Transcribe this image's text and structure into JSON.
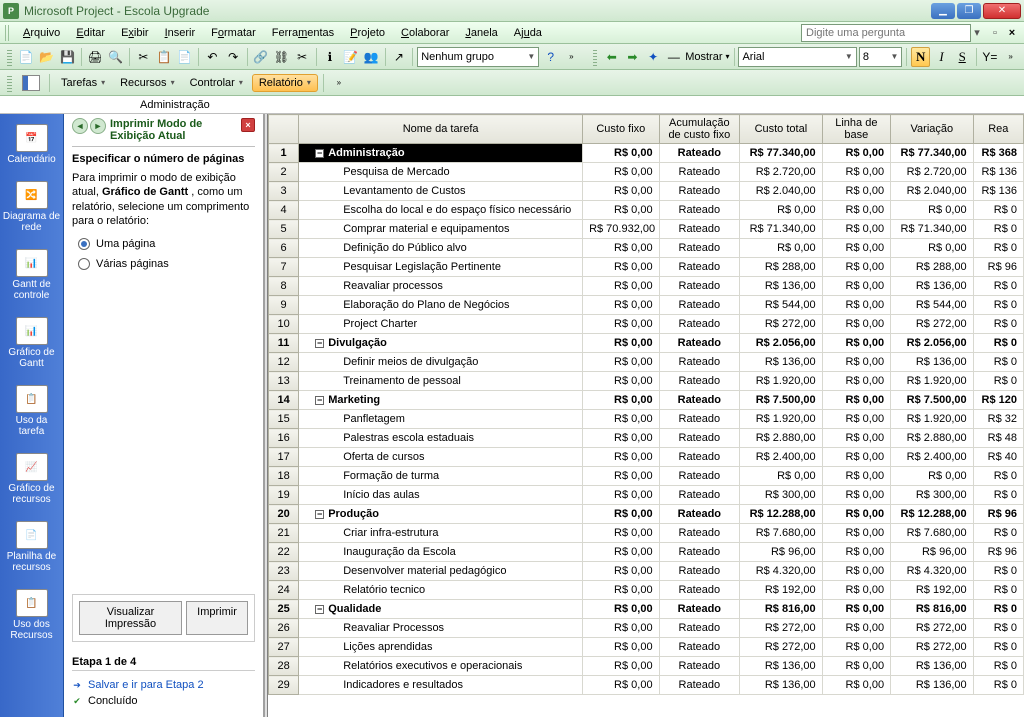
{
  "titlebar": {
    "app": "Microsoft Project",
    "doc": "Escola Upgrade"
  },
  "menubar": {
    "items": [
      "Arquivo",
      "Editar",
      "Exibir",
      "Inserir",
      "Formatar",
      "Ferramentas",
      "Projeto",
      "Colaborar",
      "Janela",
      "Ajuda"
    ],
    "search_placeholder": "Digite uma pergunta"
  },
  "toolbar1": {
    "group_combo": "Nenhum grupo",
    "show_label": "Mostrar",
    "font_combo": "Arial",
    "size_combo": "8"
  },
  "toolbar2": {
    "buttons": [
      "Tarefas",
      "Recursos",
      "Controlar",
      "Relatório"
    ]
  },
  "subheader": "Administração",
  "viewbar": {
    "items": [
      "Calendário",
      "Diagrama de rede",
      "Gantt de controle",
      "Gráfico de Gantt",
      "Uso da tarefa",
      "Gráfico de recursos",
      "Planilha de recursos",
      "Uso dos Recursos"
    ]
  },
  "guide": {
    "title": "Imprimir Modo de Exibição Atual",
    "section_title": "Especificar o número de páginas",
    "text_before": "Para imprimir o modo de exibição atual, ",
    "text_bold": "Gráfico de Gantt",
    "text_after": " , como um relatório, selecione um comprimento para o relatório:",
    "radio1": "Uma página",
    "radio2": "Várias páginas",
    "btn_preview": "Visualizar Impressão",
    "btn_print": "Imprimir",
    "step_label": "Etapa 1 de 4",
    "link_save": "Salvar e ir para Etapa 2",
    "link_done": "Concluído"
  },
  "grid": {
    "columns": [
      "Nome da tarefa",
      "Custo fixo",
      "Acumulação de custo fixo",
      "Custo total",
      "Linha de base",
      "Variação",
      "Rea"
    ],
    "rows": [
      {
        "n": 1,
        "level": 0,
        "bold": true,
        "sel": true,
        "name": "Administração",
        "fixed": "R$ 0,00",
        "accrual": "Rateado",
        "total": "R$ 77.340,00",
        "base": "R$ 0,00",
        "var": "R$ 77.340,00",
        "rem": "R$ 368"
      },
      {
        "n": 2,
        "level": 1,
        "name": "Pesquisa de Mercado",
        "fixed": "R$ 0,00",
        "accrual": "Rateado",
        "total": "R$ 2.720,00",
        "base": "R$ 0,00",
        "var": "R$ 2.720,00",
        "rem": "R$ 136"
      },
      {
        "n": 3,
        "level": 1,
        "name": "Levantamento de Custos",
        "fixed": "R$ 0,00",
        "accrual": "Rateado",
        "total": "R$ 2.040,00",
        "base": "R$ 0,00",
        "var": "R$ 2.040,00",
        "rem": "R$ 136"
      },
      {
        "n": 4,
        "level": 1,
        "name": "Escolha do local e do espaço físico necessário",
        "fixed": "R$ 0,00",
        "accrual": "Rateado",
        "total": "R$ 0,00",
        "base": "R$ 0,00",
        "var": "R$ 0,00",
        "rem": "R$ 0"
      },
      {
        "n": 5,
        "level": 1,
        "name": "Comprar material e equipamentos",
        "fixed": "R$ 70.932,00",
        "accrual": "Rateado",
        "total": "R$ 71.340,00",
        "base": "R$ 0,00",
        "var": "R$ 71.340,00",
        "rem": "R$ 0"
      },
      {
        "n": 6,
        "level": 1,
        "name": "Definição do Público alvo",
        "fixed": "R$ 0,00",
        "accrual": "Rateado",
        "total": "R$ 0,00",
        "base": "R$ 0,00",
        "var": "R$ 0,00",
        "rem": "R$ 0"
      },
      {
        "n": 7,
        "level": 1,
        "name": "Pesquisar Legislação Pertinente",
        "fixed": "R$ 0,00",
        "accrual": "Rateado",
        "total": "R$ 288,00",
        "base": "R$ 0,00",
        "var": "R$ 288,00",
        "rem": "R$ 96"
      },
      {
        "n": 8,
        "level": 1,
        "name": "Reavaliar processos",
        "fixed": "R$ 0,00",
        "accrual": "Rateado",
        "total": "R$ 136,00",
        "base": "R$ 0,00",
        "var": "R$ 136,00",
        "rem": "R$ 0"
      },
      {
        "n": 9,
        "level": 1,
        "name": "Elaboração do Plano de Negócios",
        "fixed": "R$ 0,00",
        "accrual": "Rateado",
        "total": "R$ 544,00",
        "base": "R$ 0,00",
        "var": "R$ 544,00",
        "rem": "R$ 0"
      },
      {
        "n": 10,
        "level": 1,
        "name": "Project Charter",
        "fixed": "R$ 0,00",
        "accrual": "Rateado",
        "total": "R$ 272,00",
        "base": "R$ 0,00",
        "var": "R$ 272,00",
        "rem": "R$ 0"
      },
      {
        "n": 11,
        "level": 0,
        "bold": true,
        "name": "Divulgação",
        "fixed": "R$ 0,00",
        "accrual": "Rateado",
        "total": "R$ 2.056,00",
        "base": "R$ 0,00",
        "var": "R$ 2.056,00",
        "rem": "R$ 0"
      },
      {
        "n": 12,
        "level": 1,
        "name": "Definir meios de divulgação",
        "fixed": "R$ 0,00",
        "accrual": "Rateado",
        "total": "R$ 136,00",
        "base": "R$ 0,00",
        "var": "R$ 136,00",
        "rem": "R$ 0"
      },
      {
        "n": 13,
        "level": 1,
        "name": "Treinamento de pessoal",
        "fixed": "R$ 0,00",
        "accrual": "Rateado",
        "total": "R$ 1.920,00",
        "base": "R$ 0,00",
        "var": "R$ 1.920,00",
        "rem": "R$ 0"
      },
      {
        "n": 14,
        "level": 0,
        "bold": true,
        "name": "Marketing",
        "fixed": "R$ 0,00",
        "accrual": "Rateado",
        "total": "R$ 7.500,00",
        "base": "R$ 0,00",
        "var": "R$ 7.500,00",
        "rem": "R$ 120"
      },
      {
        "n": 15,
        "level": 1,
        "name": "Panfletagem",
        "fixed": "R$ 0,00",
        "accrual": "Rateado",
        "total": "R$ 1.920,00",
        "base": "R$ 0,00",
        "var": "R$ 1.920,00",
        "rem": "R$ 32"
      },
      {
        "n": 16,
        "level": 1,
        "name": "Palestras escola estaduais",
        "fixed": "R$ 0,00",
        "accrual": "Rateado",
        "total": "R$ 2.880,00",
        "base": "R$ 0,00",
        "var": "R$ 2.880,00",
        "rem": "R$ 48"
      },
      {
        "n": 17,
        "level": 1,
        "name": "Oferta de cursos",
        "fixed": "R$ 0,00",
        "accrual": "Rateado",
        "total": "R$ 2.400,00",
        "base": "R$ 0,00",
        "var": "R$ 2.400,00",
        "rem": "R$ 40"
      },
      {
        "n": 18,
        "level": 1,
        "name": "Formação de turma",
        "fixed": "R$ 0,00",
        "accrual": "Rateado",
        "total": "R$ 0,00",
        "base": "R$ 0,00",
        "var": "R$ 0,00",
        "rem": "R$ 0"
      },
      {
        "n": 19,
        "level": 1,
        "name": "Início das aulas",
        "fixed": "R$ 0,00",
        "accrual": "Rateado",
        "total": "R$ 300,00",
        "base": "R$ 0,00",
        "var": "R$ 300,00",
        "rem": "R$ 0"
      },
      {
        "n": 20,
        "level": 0,
        "bold": true,
        "name": "Produção",
        "fixed": "R$ 0,00",
        "accrual": "Rateado",
        "total": "R$ 12.288,00",
        "base": "R$ 0,00",
        "var": "R$ 12.288,00",
        "rem": "R$ 96"
      },
      {
        "n": 21,
        "level": 1,
        "name": "Criar infra-estrutura",
        "fixed": "R$ 0,00",
        "accrual": "Rateado",
        "total": "R$ 7.680,00",
        "base": "R$ 0,00",
        "var": "R$ 7.680,00",
        "rem": "R$ 0"
      },
      {
        "n": 22,
        "level": 1,
        "name": "Inauguração da Escola",
        "fixed": "R$ 0,00",
        "accrual": "Rateado",
        "total": "R$ 96,00",
        "base": "R$ 0,00",
        "var": "R$ 96,00",
        "rem": "R$ 96"
      },
      {
        "n": 23,
        "level": 1,
        "name": "Desenvolver material pedagógico",
        "fixed": "R$ 0,00",
        "accrual": "Rateado",
        "total": "R$ 4.320,00",
        "base": "R$ 0,00",
        "var": "R$ 4.320,00",
        "rem": "R$ 0"
      },
      {
        "n": 24,
        "level": 1,
        "name": "Relatório tecnico",
        "fixed": "R$ 0,00",
        "accrual": "Rateado",
        "total": "R$ 192,00",
        "base": "R$ 0,00",
        "var": "R$ 192,00",
        "rem": "R$ 0"
      },
      {
        "n": 25,
        "level": 0,
        "bold": true,
        "name": "Qualidade",
        "fixed": "R$ 0,00",
        "accrual": "Rateado",
        "total": "R$ 816,00",
        "base": "R$ 0,00",
        "var": "R$ 816,00",
        "rem": "R$ 0"
      },
      {
        "n": 26,
        "level": 1,
        "name": "Reavaliar Processos",
        "fixed": "R$ 0,00",
        "accrual": "Rateado",
        "total": "R$ 272,00",
        "base": "R$ 0,00",
        "var": "R$ 272,00",
        "rem": "R$ 0"
      },
      {
        "n": 27,
        "level": 1,
        "name": "Lições aprendidas",
        "fixed": "R$ 0,00",
        "accrual": "Rateado",
        "total": "R$ 272,00",
        "base": "R$ 0,00",
        "var": "R$ 272,00",
        "rem": "R$ 0"
      },
      {
        "n": 28,
        "level": 1,
        "name": "Relatórios executivos e operacionais",
        "fixed": "R$ 0,00",
        "accrual": "Rateado",
        "total": "R$ 136,00",
        "base": "R$ 0,00",
        "var": "R$ 136,00",
        "rem": "R$ 0"
      },
      {
        "n": 29,
        "level": 1,
        "name": "Indicadores e resultados",
        "fixed": "R$ 0,00",
        "accrual": "Rateado",
        "total": "R$ 136,00",
        "base": "R$ 0,00",
        "var": "R$ 136,00",
        "rem": "R$ 0"
      }
    ]
  }
}
